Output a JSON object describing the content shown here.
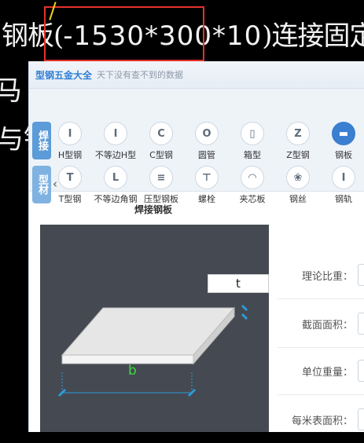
{
  "background": {
    "line1_prefix": "钢板(",
    "line1_dim": "-1530*300*10",
    "line1_suffix": ")连接固定",
    "frag2": "马",
    "frag3": "与钢"
  },
  "app": {
    "name": "型钢五金大全",
    "slogan": "天下没有查不到的数据"
  },
  "categories": [
    {
      "label": "焊接",
      "color": "#5b9bd7"
    },
    {
      "label": "型材",
      "color": "#7fb2e0"
    }
  ],
  "toolbar_rows": [
    [
      {
        "label": "H型钢",
        "icon": "h-beam-icon",
        "glyph": "I"
      },
      {
        "label": "不等边H型",
        "icon": "unequal-h-icon",
        "glyph": "I"
      },
      {
        "label": "C型钢",
        "icon": "c-channel-icon",
        "glyph": "C"
      },
      {
        "label": "圆管",
        "icon": "round-tube-icon",
        "glyph": "O"
      },
      {
        "label": "箱型",
        "icon": "box-section-icon",
        "glyph": "▯"
      },
      {
        "label": "Z型钢",
        "icon": "z-section-icon",
        "glyph": "Z"
      },
      {
        "label": "钢板",
        "icon": "steel-plate-icon",
        "glyph": "▬",
        "active": true
      }
    ],
    [
      {
        "label": "T型钢",
        "icon": "t-beam-icon",
        "glyph": "T"
      },
      {
        "label": "不等边角钢",
        "icon": "unequal-angle-icon",
        "glyph": "L"
      },
      {
        "label": "压型钢板",
        "icon": "corrugated-plate-icon",
        "glyph": "≡"
      },
      {
        "label": "螺栓",
        "icon": "bolt-icon",
        "glyph": "⊤"
      },
      {
        "label": "夹芯板",
        "icon": "sandwich-panel-icon",
        "glyph": "◠"
      },
      {
        "label": "钢丝",
        "icon": "steel-wire-icon",
        "glyph": "❀"
      },
      {
        "label": "钢轨",
        "icon": "rail-icon",
        "glyph": "I"
      }
    ]
  ],
  "panel": {
    "title": "焊接钢板",
    "dim_t": "t",
    "dim_b": "b"
  },
  "properties": [
    {
      "label": "理论比重："
    },
    {
      "label": "截面面积："
    },
    {
      "label": "单位重量："
    },
    {
      "label": "每米表面积："
    }
  ]
}
